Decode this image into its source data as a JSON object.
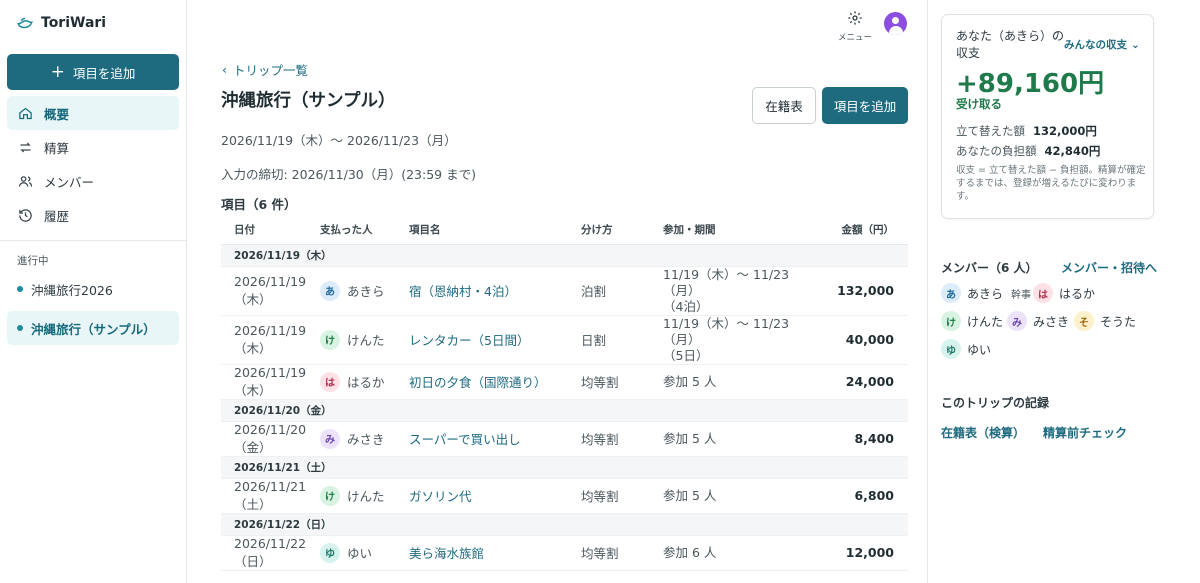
{
  "app": {
    "name": "ToriWari"
  },
  "sidebar": {
    "add_label": "項目を追加",
    "nav": [
      {
        "label": "概要",
        "icon": "home-icon"
      },
      {
        "label": "精算",
        "icon": "swap-icon"
      },
      {
        "label": "メンバー",
        "icon": "users-icon"
      },
      {
        "label": "履歴",
        "icon": "history-icon"
      }
    ],
    "section_label": "進行中",
    "trips": [
      {
        "label": "沖縄旅行2026"
      },
      {
        "label": "沖縄旅行（サンプル）"
      }
    ]
  },
  "header": {
    "menu_label": "メニュー"
  },
  "main": {
    "back_label": "トリップ一覧",
    "title": "沖縄旅行（サンプル）",
    "roster_button": "在籍表",
    "add_button": "項目を追加",
    "date_range": "2026/11/19（木）〜 2026/11/23（月）",
    "deadline": "入力の締切: 2026/11/30（月）(23:59 まで)",
    "items_title": "項目（6 件）",
    "columns": [
      "日付",
      "支払った人",
      "項目名",
      "分け方",
      "参加・期間",
      "金額（円）"
    ],
    "groups": [
      {
        "date": "2026/11/19（木）",
        "rows": [
          {
            "date": "2026/11/19（木）",
            "payer_initial": "あ",
            "payer": "あきら",
            "name": "宿（恩納村・4泊）",
            "split": "泊割",
            "part_1": "11/19（木）〜 11/23（月）",
            "part_2": "（4泊）",
            "amount": "132,000"
          },
          {
            "date": "2026/11/19（木）",
            "payer_initial": "け",
            "payer": "けんた",
            "name": "レンタカー（5日間）",
            "split": "日割",
            "part_1": "11/19（木）〜 11/23（月）",
            "part_2": "（5日）",
            "amount": "40,000"
          },
          {
            "date": "2026/11/19（木）",
            "payer_initial": "は",
            "payer": "はるか",
            "name": "初日の夕食（国際通り）",
            "split": "均等割",
            "part_1": "参加 5 人",
            "part_2": "",
            "amount": "24,000"
          }
        ]
      },
      {
        "date": "2026/11/20（金）",
        "rows": [
          {
            "date": "2026/11/20（金）",
            "payer_initial": "み",
            "payer": "みさき",
            "name": "スーパーで買い出し",
            "split": "均等割",
            "part_1": "参加 5 人",
            "part_2": "",
            "amount": "8,400"
          }
        ]
      },
      {
        "date": "2026/11/21（土）",
        "rows": [
          {
            "date": "2026/11/21（土）",
            "payer_initial": "け",
            "payer": "けんた",
            "name": "ガソリン代",
            "split": "均等割",
            "part_1": "参加 5 人",
            "part_2": "",
            "amount": "6,800"
          }
        ]
      },
      {
        "date": "2026/11/22（日）",
        "rows": [
          {
            "date": "2026/11/22（日）",
            "payer_initial": "ゆ",
            "payer": "ゆい",
            "name": "美ら海水族館",
            "split": "均等割",
            "part_1": "参加 6 人",
            "part_2": "",
            "amount": "12,000"
          }
        ]
      }
    ]
  },
  "summary": {
    "label": "あなた（あきら）の収支",
    "filter": "みんなの収支",
    "amount": "+89,160円",
    "status": "受け取る",
    "paid_label": "立て替えた額",
    "paid_value": "132,000円",
    "share_label": "あなたの負担額",
    "share_value": "42,840円",
    "note": "収支 = 立て替えた額 − 負担額。精算が確定するまでは、登録が増えるたびに変わります。"
  },
  "members": {
    "title": "メンバー（6 人）",
    "link": "メンバー・招待へ",
    "list": [
      {
        "initial": "あ",
        "name": "あきら",
        "badge": "幹事"
      },
      {
        "initial": "は",
        "name": "はるか",
        "badge": ""
      },
      {
        "initial": "け",
        "name": "けんた",
        "badge": ""
      },
      {
        "initial": "み",
        "name": "みさき",
        "badge": ""
      },
      {
        "initial": "そ",
        "name": "そうた",
        "badge": ""
      },
      {
        "initial": "ゆ",
        "name": "ゆい",
        "badge": ""
      }
    ]
  },
  "records": {
    "title": "このトリップの記録",
    "links": [
      "在籍表（検算）",
      "精算前チェック"
    ]
  },
  "colors": {
    "primary": "#1e6b80",
    "positive": "#1e7a4a",
    "avatar_a": "#dcecfb",
    "avatar_ha": "#fde1e6",
    "avatar_ke": "#d9f3e3",
    "avatar_mi": "#ece3fb",
    "avatar_so": "#fdf1cc",
    "avatar_yu": "#d6f3ee"
  }
}
